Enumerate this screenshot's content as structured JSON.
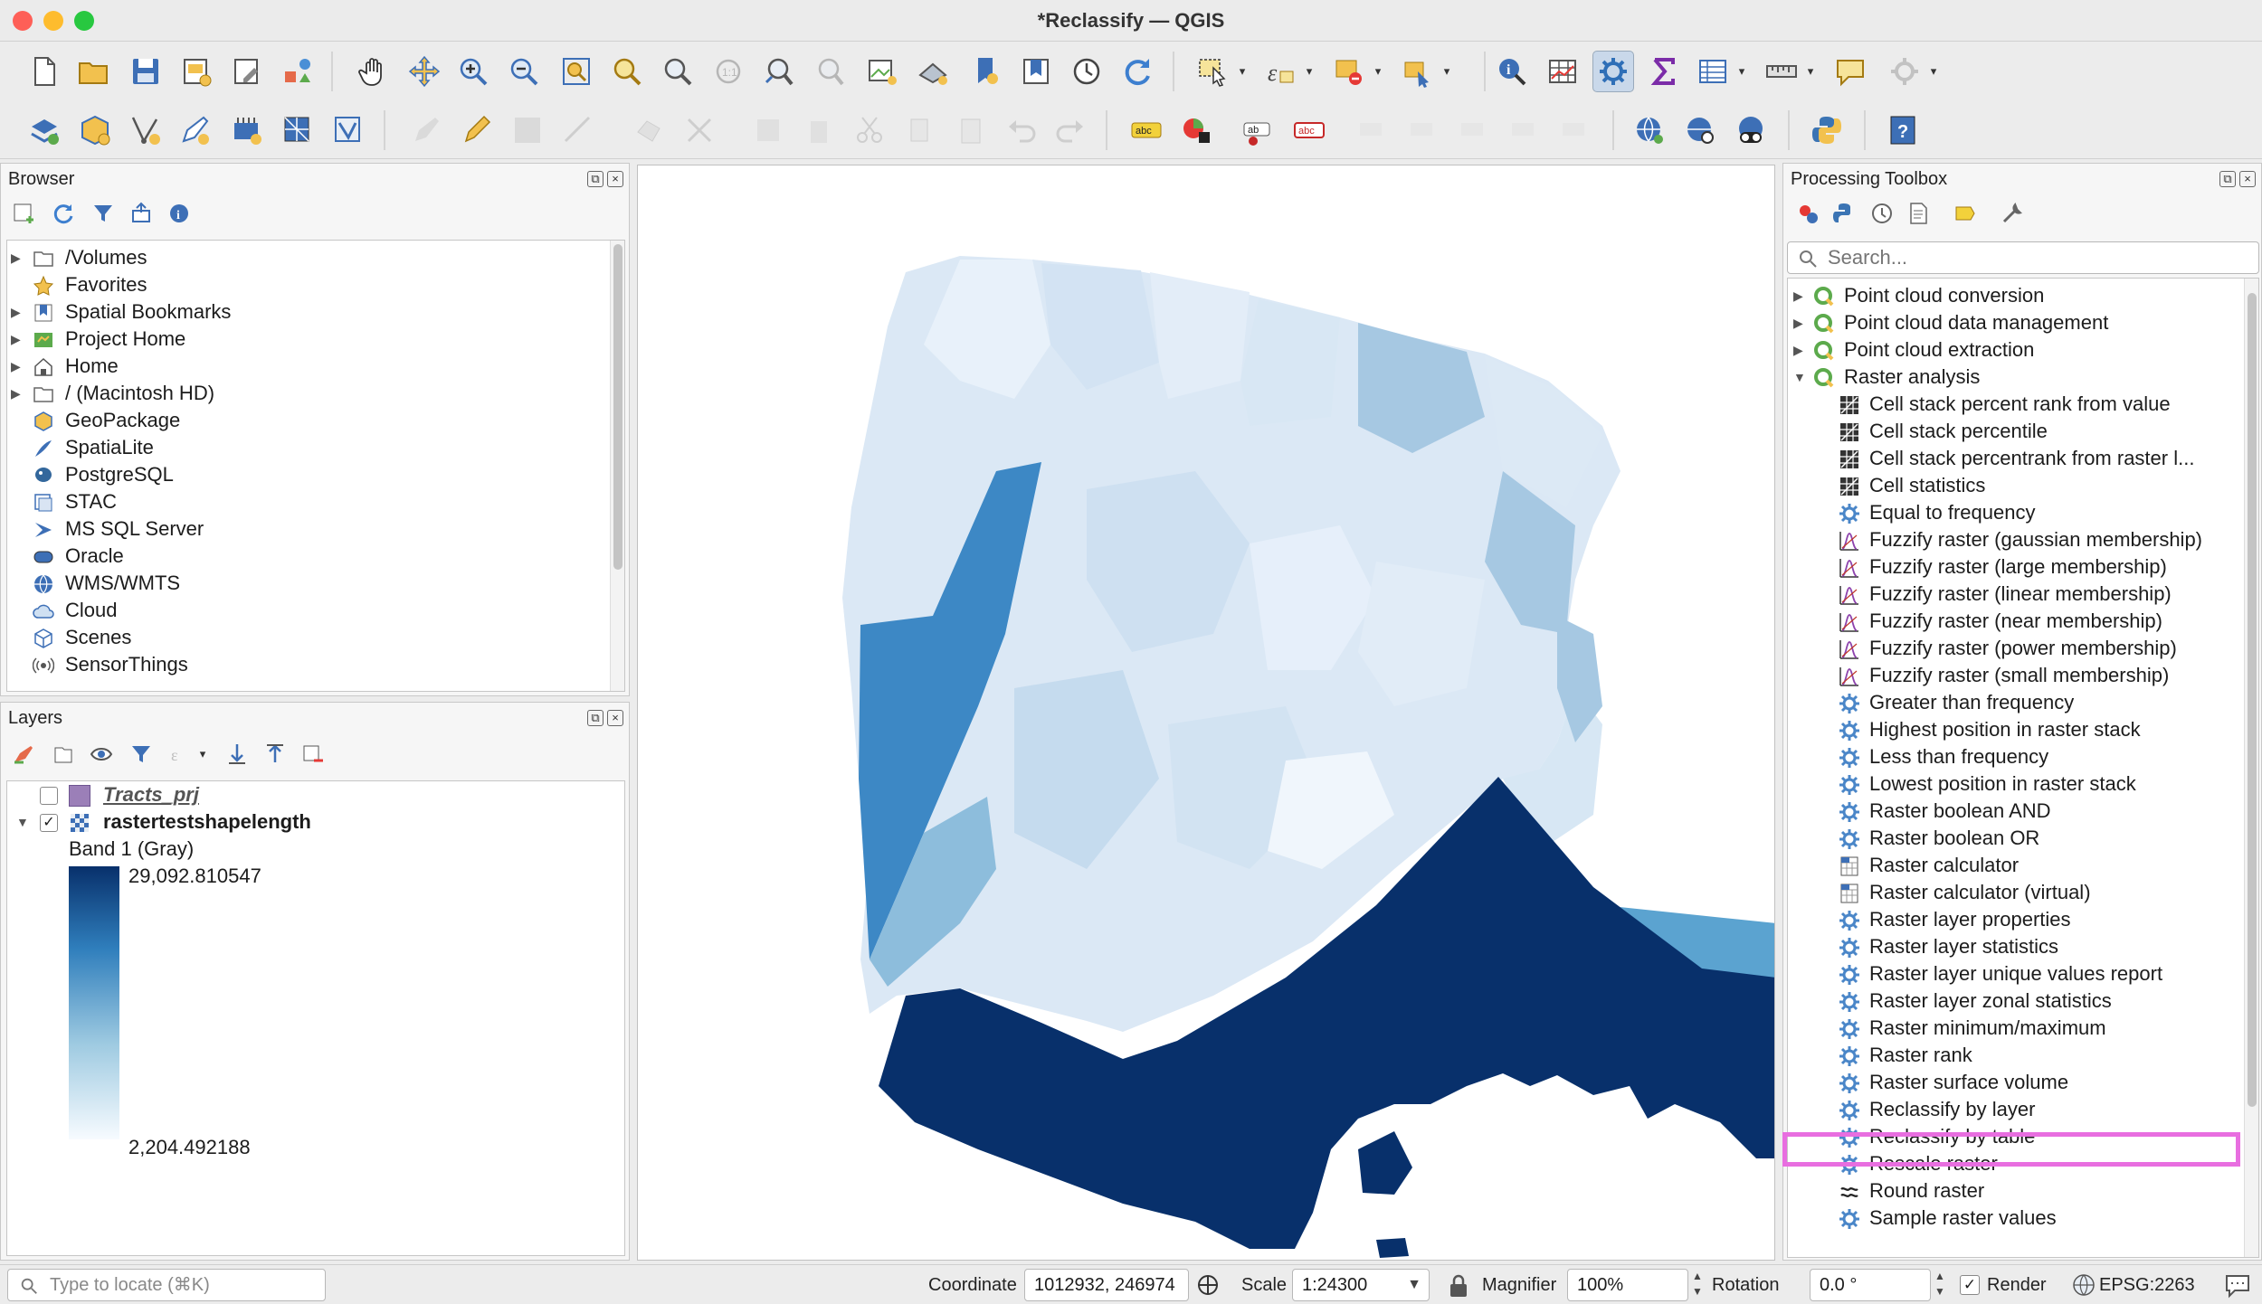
{
  "window": {
    "title": "*Reclassify — QGIS"
  },
  "colors": {
    "accent_highlight": "#e86ee0",
    "ramp_dark": "#08306b",
    "ramp_light": "#f7fbff",
    "panel_bg": "#f6f6f6"
  },
  "browser": {
    "title": "Browser",
    "toolbar_icons": [
      "add-layer-icon",
      "refresh-icon",
      "filter-icon",
      "collapse-icon",
      "info-icon"
    ],
    "items": [
      {
        "label": "/Volumes",
        "icon": "folder-icon",
        "expandable": true
      },
      {
        "label": "Favorites",
        "icon": "star-icon",
        "expandable": false
      },
      {
        "label": "Spatial Bookmarks",
        "icon": "bookmark-icon",
        "expandable": true
      },
      {
        "label": "Project Home",
        "icon": "project-home-icon",
        "expandable": true
      },
      {
        "label": "Home",
        "icon": "home-icon",
        "expandable": true
      },
      {
        "label": "/ (Macintosh HD)",
        "icon": "folder-icon",
        "expandable": true
      },
      {
        "label": "GeoPackage",
        "icon": "geopackage-icon",
        "expandable": false
      },
      {
        "label": "SpatiaLite",
        "icon": "spatialite-icon",
        "expandable": false
      },
      {
        "label": "PostgreSQL",
        "icon": "postgresql-icon",
        "expandable": false
      },
      {
        "label": "STAC",
        "icon": "stac-icon",
        "expandable": false
      },
      {
        "label": "MS SQL Server",
        "icon": "mssql-icon",
        "expandable": false
      },
      {
        "label": "Oracle",
        "icon": "oracle-icon",
        "expandable": false
      },
      {
        "label": "WMS/WMTS",
        "icon": "globe-icon",
        "expandable": false
      },
      {
        "label": "Cloud",
        "icon": "cloud-icon",
        "expandable": false
      },
      {
        "label": "Scenes",
        "icon": "scenes-icon",
        "expandable": false
      },
      {
        "label": "SensorThings",
        "icon": "sensor-icon",
        "expandable": false
      }
    ]
  },
  "layers": {
    "title": "Layers",
    "items": [
      {
        "name": "Tracts_prj",
        "checked": false,
        "color": "#9b7fb8"
      },
      {
        "name": "rastertestshapelength",
        "checked": true
      }
    ],
    "band_label": "Band 1 (Gray)",
    "ramp_max": "29,092.810547",
    "ramp_min": "2,204.492188"
  },
  "toolbox": {
    "title": "Processing Toolbox",
    "search_placeholder": "Search...",
    "groups": [
      {
        "label": "Point cloud conversion",
        "expanded": false
      },
      {
        "label": "Point cloud data management",
        "expanded": false
      },
      {
        "label": "Point cloud extraction",
        "expanded": false
      },
      {
        "label": "Raster analysis",
        "expanded": true
      }
    ],
    "algorithms": [
      {
        "label": "Cell stack percent rank from value",
        "icon": "grid-icon"
      },
      {
        "label": "Cell stack percentile",
        "icon": "grid-icon"
      },
      {
        "label": "Cell stack percentrank from raster l...",
        "icon": "grid-icon"
      },
      {
        "label": "Cell statistics",
        "icon": "grid-icon"
      },
      {
        "label": "Equal to frequency",
        "icon": "gear-icon"
      },
      {
        "label": "Fuzzify raster (gaussian membership)",
        "icon": "fuzzy-icon"
      },
      {
        "label": "Fuzzify raster (large membership)",
        "icon": "fuzzy-icon"
      },
      {
        "label": "Fuzzify raster (linear membership)",
        "icon": "fuzzy-icon"
      },
      {
        "label": "Fuzzify raster (near membership)",
        "icon": "fuzzy-icon"
      },
      {
        "label": "Fuzzify raster (power membership)",
        "icon": "fuzzy-icon"
      },
      {
        "label": "Fuzzify raster (small membership)",
        "icon": "fuzzy-icon"
      },
      {
        "label": "Greater than frequency",
        "icon": "gear-icon"
      },
      {
        "label": "Highest position in raster stack",
        "icon": "gear-icon"
      },
      {
        "label": "Less than frequency",
        "icon": "gear-icon"
      },
      {
        "label": "Lowest position in raster stack",
        "icon": "gear-icon"
      },
      {
        "label": "Raster boolean AND",
        "icon": "gear-icon"
      },
      {
        "label": "Raster boolean OR",
        "icon": "gear-icon"
      },
      {
        "label": "Raster calculator",
        "icon": "calculator-icon"
      },
      {
        "label": "Raster calculator (virtual)",
        "icon": "calculator-icon"
      },
      {
        "label": "Raster layer properties",
        "icon": "gear-icon"
      },
      {
        "label": "Raster layer statistics",
        "icon": "gear-icon"
      },
      {
        "label": "Raster layer unique values report",
        "icon": "gear-icon"
      },
      {
        "label": "Raster layer zonal statistics",
        "icon": "gear-icon"
      },
      {
        "label": "Raster minimum/maximum",
        "icon": "gear-icon"
      },
      {
        "label": "Raster rank",
        "icon": "gear-icon"
      },
      {
        "label": "Raster surface volume",
        "icon": "gear-icon"
      },
      {
        "label": "Reclassify by layer",
        "icon": "gear-icon"
      },
      {
        "label": "Reclassify by table",
        "icon": "gear-icon",
        "highlighted": true
      },
      {
        "label": "Rescale raster",
        "icon": "gear-icon"
      },
      {
        "label": "Round raster",
        "icon": "round-icon"
      },
      {
        "label": "Sample raster values",
        "icon": "gear-icon"
      }
    ]
  },
  "statusbar": {
    "locate_placeholder": "Type to locate (⌘K)",
    "coordinate_label": "Coordinate",
    "coordinate_value": "1012932, 246974",
    "scale_label": "Scale",
    "scale_value": "1:24300",
    "magnifier_label": "Magnifier",
    "magnifier_value": "100%",
    "rotation_label": "Rotation",
    "rotation_value": "0.0 °",
    "render_label": "Render",
    "render_checked": true,
    "crs": "EPSG:2263"
  }
}
